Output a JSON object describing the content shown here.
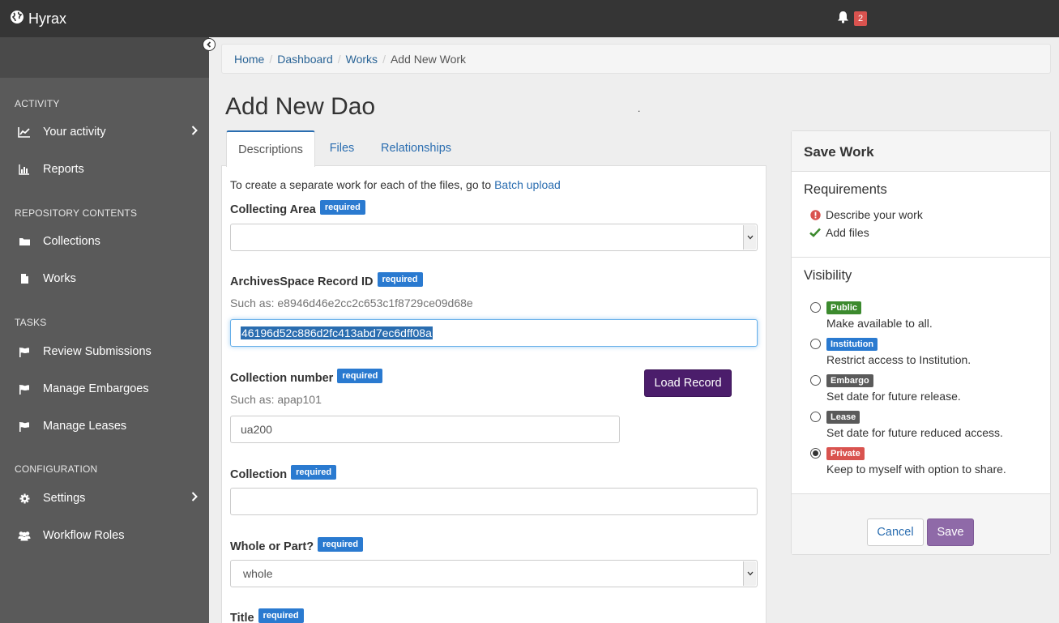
{
  "app": {
    "name": "Hyrax",
    "notification_count": "2"
  },
  "sidebar": {
    "sections": [
      {
        "label": "ACTIVITY"
      },
      {
        "label": "REPOSITORY CONTENTS"
      },
      {
        "label": "TASKS"
      },
      {
        "label": "CONFIGURATION"
      }
    ],
    "items": [
      {
        "label": "Your activity",
        "icon": "line-chart-icon"
      },
      {
        "label": "Reports",
        "icon": "bar-chart-icon"
      },
      {
        "label": "Collections",
        "icon": "folder-icon"
      },
      {
        "label": "Works",
        "icon": "file-icon"
      },
      {
        "label": "Review Submissions",
        "icon": "flag-icon"
      },
      {
        "label": "Manage Embargoes",
        "icon": "flag-icon"
      },
      {
        "label": "Manage Leases",
        "icon": "flag-icon"
      },
      {
        "label": "Settings",
        "icon": "gear-icon"
      },
      {
        "label": "Workflow Roles",
        "icon": "users-icon"
      }
    ]
  },
  "breadcrumb": {
    "home": "Home",
    "dashboard": "Dashboard",
    "works": "Works",
    "current": "Add New Work"
  },
  "page": {
    "title": "Add New Dao",
    "dot": "."
  },
  "tabs": {
    "descriptions": "Descriptions",
    "files": "Files",
    "relationships": "Relationships"
  },
  "form": {
    "intro_text": "To create a separate work for each of the files, go to ",
    "intro_link": "Batch upload",
    "required_label": "required",
    "collecting_area": {
      "label": "Collecting Area",
      "value": ""
    },
    "archivesspace_id": {
      "label": "ArchivesSpace Record ID",
      "help": "Such as: e8946d46e2cc2c653c1f8729ce09d68e",
      "value": "46196d52c886d2fc413abd7ec6dff08a"
    },
    "collection_number": {
      "label": "Collection number",
      "help": "Such as: apap101",
      "value": "ua200"
    },
    "load_record": "Load Record",
    "collection": {
      "label": "Collection",
      "value": ""
    },
    "whole_or_part": {
      "label": "Whole or Part?",
      "value": "whole"
    },
    "title": {
      "label": "Title"
    }
  },
  "save_work": {
    "title": "Save Work",
    "requirements_title": "Requirements",
    "requirements": [
      {
        "label": "Describe your work",
        "status": "missing"
      },
      {
        "label": "Add files",
        "status": "complete"
      }
    ],
    "visibility_title": "Visibility",
    "visibility": [
      {
        "badge": "Public",
        "color": "#3c8a2e",
        "desc": "Make available to all.",
        "selected": false
      },
      {
        "badge": "Institution",
        "color": "#2a7ad0",
        "desc": "Restrict access to Institution.",
        "selected": false
      },
      {
        "badge": "Embargo",
        "color": "#5a5a5a",
        "desc": "Set date for future release.",
        "selected": false
      },
      {
        "badge": "Lease",
        "color": "#5a5a5a",
        "desc": "Set date for future reduced access.",
        "selected": false
      },
      {
        "badge": "Private",
        "color": "#d9534f",
        "desc": "Keep to myself with option to share.",
        "selected": true
      }
    ],
    "cancel": "Cancel",
    "save": "Save"
  }
}
